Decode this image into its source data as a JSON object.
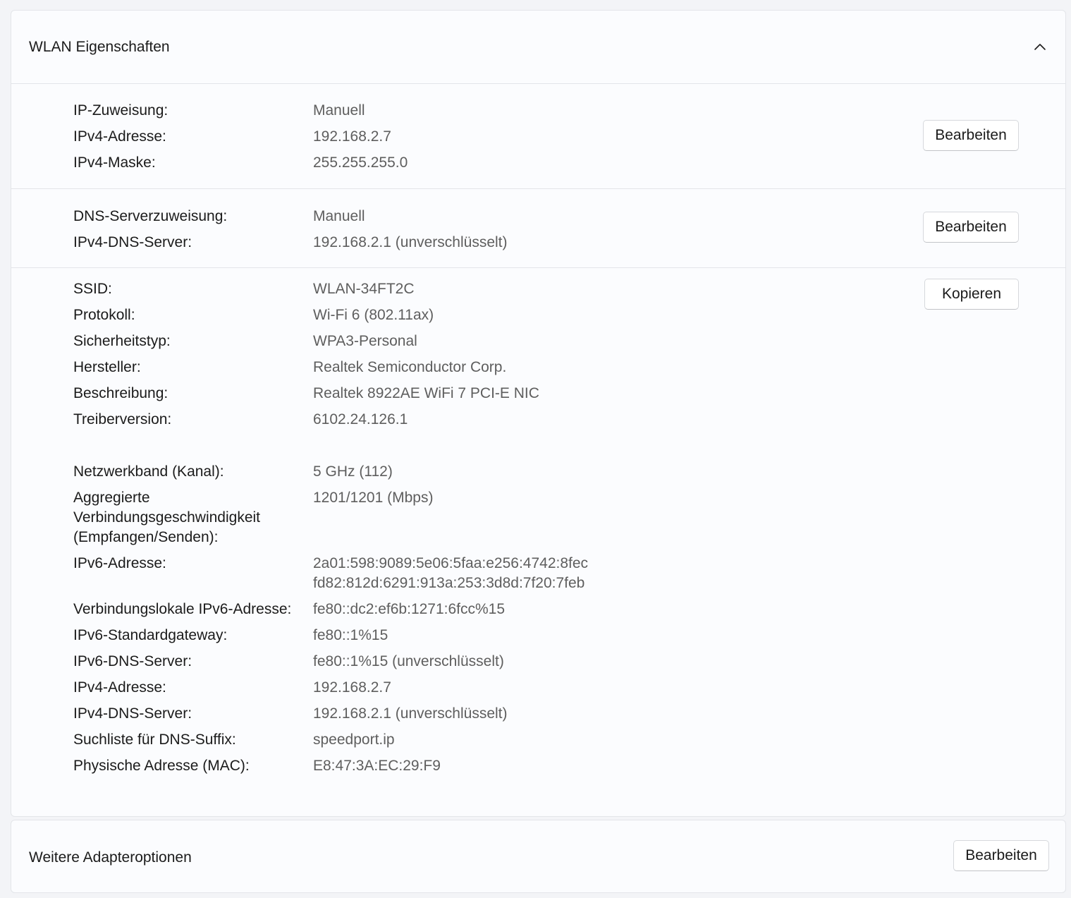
{
  "wlan": {
    "title": "WLAN Eigenschaften",
    "ip_section": {
      "rows": [
        {
          "label": "IP-Zuweisung:",
          "value": "Manuell"
        },
        {
          "label": "IPv4-Adresse:",
          "value": "192.168.2.7"
        },
        {
          "label": "IPv4-Maske:",
          "value": "255.255.255.0"
        }
      ],
      "button": "Bearbeiten"
    },
    "dns_section": {
      "rows": [
        {
          "label": "DNS-Serverzuweisung:",
          "value": "Manuell"
        },
        {
          "label": "IPv4-DNS-Server:",
          "value": "192.168.2.1 (unverschlüsselt)"
        }
      ],
      "button": "Bearbeiten"
    },
    "info_section": {
      "button": "Kopieren",
      "rows": [
        {
          "label": "SSID:",
          "value": "WLAN-34FT2C"
        },
        {
          "label": "Protokoll:",
          "value": "Wi-Fi 6 (802.11ax)"
        },
        {
          "label": "Sicherheitstyp:",
          "value": "WPA3-Personal"
        },
        {
          "label": "Hersteller:",
          "value": "Realtek Semiconductor Corp."
        },
        {
          "label": "Beschreibung:",
          "value": "Realtek 8922AE WiFi 7 PCI-E NIC"
        },
        {
          "label": "Treiberversion:",
          "value": "6102.24.126.1"
        },
        {
          "label": "Netzwerkband (Kanal):",
          "value": "5 GHz (112)"
        },
        {
          "label": "Aggregierte",
          "value": "1201/1201 (Mbps)"
        },
        {
          "label": "Verbindungsgeschwindigkeit",
          "value": ""
        },
        {
          "label": "(Empfangen/Senden):",
          "value": ""
        },
        {
          "label": "IPv6-Adresse:",
          "value": "2a01:598:9089:5e06:5faa:e256:4742:8fec"
        },
        {
          "label": "",
          "value": "fd82:812d:6291:913a:253:3d8d:7f20:7feb"
        },
        {
          "label": "Verbindungslokale IPv6-Adresse:",
          "value": "fe80::dc2:ef6b:1271:6fcc%15"
        },
        {
          "label": "IPv6-Standardgateway:",
          "value": "fe80::1%15"
        },
        {
          "label": "IPv6-DNS-Server:",
          "value": "fe80::1%15 (unverschlüsselt)"
        },
        {
          "label": "IPv4-Adresse:",
          "value": "192.168.2.7"
        },
        {
          "label": "IPv4-DNS-Server:",
          "value": "192.168.2.1 (unverschlüsselt)"
        },
        {
          "label": "Suchliste für DNS-Suffix:",
          "value": "speedport.ip"
        },
        {
          "label": "Physische Adresse (MAC):",
          "value": "E8:47:3A:EC:29:F9"
        }
      ]
    }
  },
  "adapter": {
    "title": "Weitere Adapteroptionen",
    "button": "Bearbeiten"
  },
  "icons": {
    "collapse": "chevron-up-icon"
  }
}
